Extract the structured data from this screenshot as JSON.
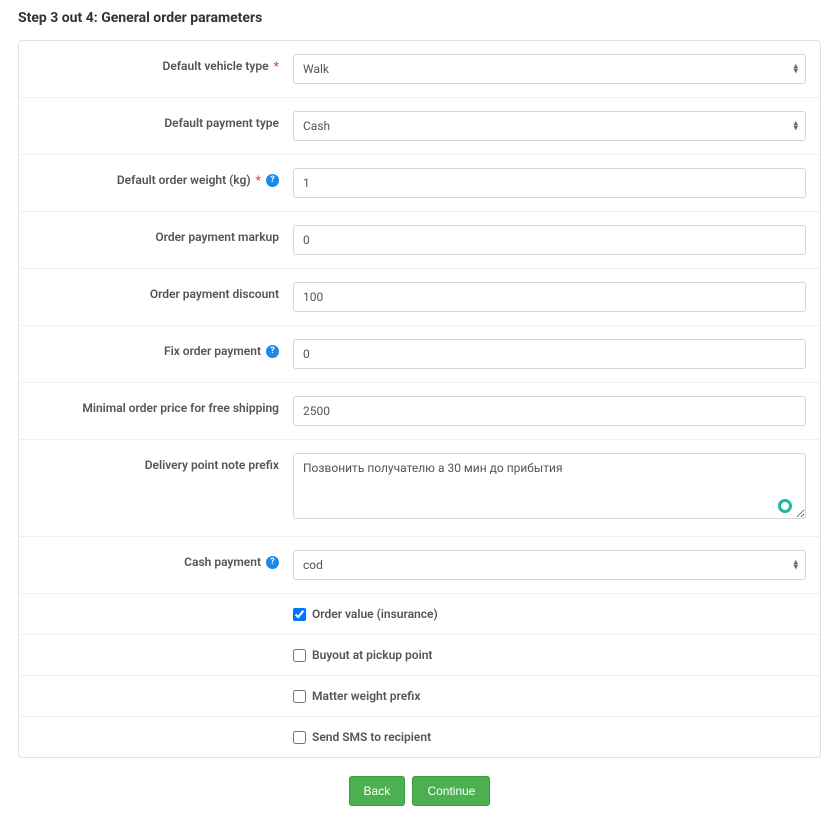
{
  "step_title": "Step 3 out 4: General order parameters",
  "labels": {
    "default_vehicle_type": "Default vehicle type",
    "default_payment_type": "Default payment type",
    "default_order_weight": "Default order weight (kg)",
    "order_payment_markup": "Order payment markup",
    "order_payment_discount": "Order payment discount",
    "fix_order_payment": "Fix order payment",
    "min_order_free_shipping": "Minimal order price for free shipping",
    "delivery_point_note_prefix": "Delivery point note prefix",
    "cash_payment": "Cash payment",
    "order_value_insurance": "Order value (insurance)",
    "buyout_at_pickup": "Buyout at pickup point",
    "matter_weight_prefix": "Matter weight prefix",
    "send_sms": "Send SMS to recipient"
  },
  "values": {
    "default_vehicle_type": "Walk",
    "default_payment_type": "Cash",
    "default_order_weight": "1",
    "order_payment_markup": "0",
    "order_payment_discount": "100",
    "fix_order_payment": "0",
    "min_order_free_shipping": "2500",
    "delivery_point_note_prefix": "Позвонить получателю а 30 мин до прибытия",
    "cash_payment": "cod"
  },
  "checked": {
    "order_value_insurance": true,
    "buyout_at_pickup": false,
    "matter_weight_prefix": false,
    "send_sms": false
  },
  "buttons": {
    "back": "Back",
    "continue": "Continue"
  },
  "symbols": {
    "required": "*",
    "help": "?"
  }
}
